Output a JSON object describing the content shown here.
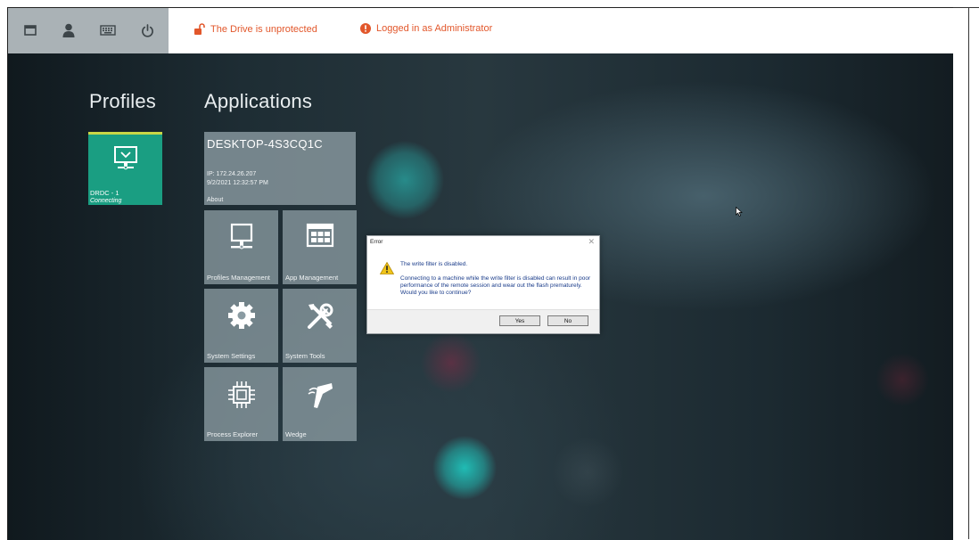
{
  "taskbar": {
    "icons": [
      "window-icon",
      "user-icon",
      "keyboard-icon",
      "power-icon"
    ],
    "status_drive": "The Drive is unprotected",
    "status_login": "Logged in as Administrator",
    "status_color": "#e2572b"
  },
  "sections": {
    "profiles": "Profiles",
    "applications": "Applications"
  },
  "profile": {
    "name": "DRDC - 1",
    "status": "Connecting",
    "color": "#1a9e82"
  },
  "desktop": {
    "name": "DESKTOP-4S3CQ1C",
    "ip": "IP: 172.24.26.207",
    "datetime": "9/2/2021 12:32:57 PM",
    "about": "About"
  },
  "apps": [
    {
      "label": "Profiles Management",
      "icon": "monitor-icon"
    },
    {
      "label": "App Management",
      "icon": "grid-window-icon"
    },
    {
      "label": "System Settings",
      "icon": "gear-icon"
    },
    {
      "label": "System Tools",
      "icon": "tools-icon"
    },
    {
      "label": "Process Explorer",
      "icon": "chip-icon"
    },
    {
      "label": "Wedge",
      "icon": "barcode-scanner-icon"
    }
  ],
  "dialog": {
    "title": "Error",
    "heading": "The write filter is disabled.",
    "message": "Connecting to a machine while the write filter is disabled can result in poor performance of the remote session and wear out the flash prematurely. Would you like to continue?",
    "yes": "Yes",
    "no": "No"
  }
}
